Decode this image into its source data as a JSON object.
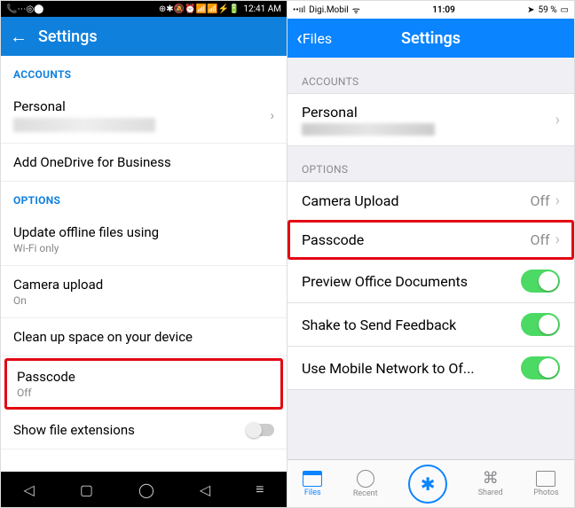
{
  "android": {
    "status": {
      "icons": "📞⋯◎⬤",
      "right": "⊕✱🔕⏰📶📶⚡🔋",
      "time": "12:41 AM"
    },
    "header": {
      "title": "Settings"
    },
    "sections": {
      "accounts": "ACCOUNTS",
      "options": "OPTIONS"
    },
    "rows": {
      "personal": "Personal",
      "addBusiness": "Add OneDrive for Business",
      "updateOffline": {
        "label": "Update offline files using",
        "sub": "Wi-Fi only"
      },
      "cameraUpload": {
        "label": "Camera upload",
        "sub": "On"
      },
      "cleanUp": "Clean up space on your device",
      "passcode": {
        "label": "Passcode",
        "sub": "Off"
      },
      "showExt": "Show file extensions"
    }
  },
  "ios": {
    "status": {
      "carrier": "Digi.Mobil",
      "time": "11:09",
      "battery": "59 %"
    },
    "header": {
      "back": "Files",
      "title": "Settings"
    },
    "sections": {
      "accounts": "ACCOUNTS",
      "options": "OPTIONS"
    },
    "rows": {
      "personal": "Personal",
      "cameraUpload": {
        "label": "Camera Upload",
        "val": "Off"
      },
      "passcode": {
        "label": "Passcode",
        "val": "Off"
      },
      "preview": "Preview Office Documents",
      "shake": "Shake to Send Feedback",
      "mobile": "Use Mobile Network to Of..."
    },
    "tabs": {
      "files": "Files",
      "recent": "Recent",
      "shared": "Shared",
      "photos": "Photos"
    }
  }
}
